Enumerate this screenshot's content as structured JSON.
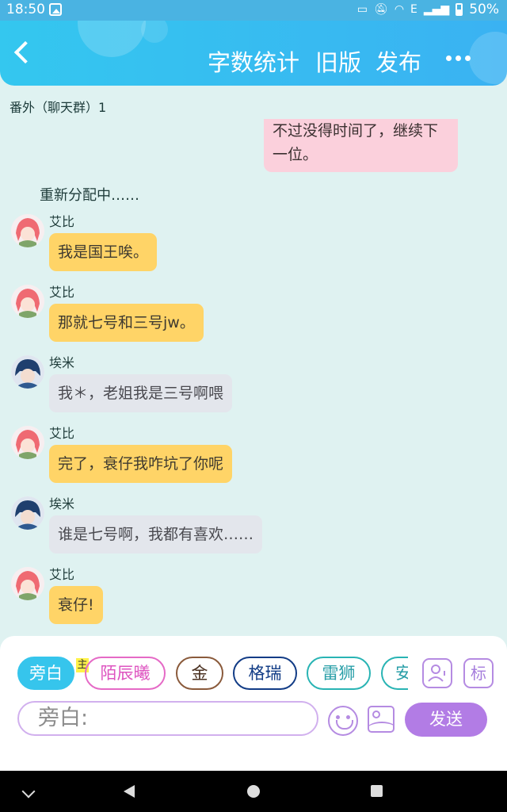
{
  "status": {
    "time": "18:50",
    "network": "E",
    "battery": "50%"
  },
  "header": {
    "word_count": "字数统计",
    "old_version": "旧版",
    "publish": "发布"
  },
  "group": {
    "title": "番外（聊天群）1"
  },
  "chat": {
    "partial_message": "不过没得时间了，继续下一位。",
    "narration": "重新分配中……",
    "messages": [
      {
        "name": "艾比",
        "text": "我是国王唉。",
        "avatar": "pink-hair-girl"
      },
      {
        "name": "艾比",
        "text": "那就七号和三号jw。",
        "avatar": "pink-hair-girl"
      },
      {
        "name": "埃米",
        "text": "我＊，老姐我是三号啊喂",
        "avatar": "dark-hair-boy"
      },
      {
        "name": "艾比",
        "text": "完了，衰仔我咋坑了你呢",
        "avatar": "pink-hair-girl"
      },
      {
        "name": "埃米",
        "text": "谁是七号啊，我都有喜欢……",
        "avatar": "dark-hair-boy"
      },
      {
        "name": "艾比",
        "text": "衰仔!",
        "avatar": "pink-hair-girl"
      }
    ]
  },
  "composer": {
    "characters": [
      "旁白",
      "陌辰曦",
      "金",
      "格瑞",
      "雷狮",
      "安"
    ],
    "host_badge": "主",
    "role_icon": "role-icon",
    "mark_label": "标",
    "input_placeholder": "旁白:",
    "send_label": "发送",
    "colors": {
      "active_chip": "#36c5ec",
      "accent_purple": "#b27ce5"
    }
  }
}
